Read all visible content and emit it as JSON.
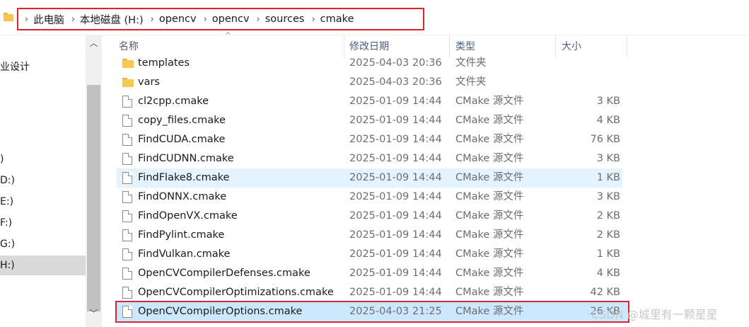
{
  "breadcrumb": [
    "此电脑",
    "本地磁盘 (H:)",
    "opencv",
    "opencv",
    "sources",
    "cmake"
  ],
  "nav": {
    "items": [
      "业设计",
      ")",
      "D:)",
      "E:)",
      "F:)",
      "G:)",
      "H:)"
    ],
    "selected": "H:)"
  },
  "columns": {
    "name": "名称",
    "date": "修改日期",
    "type": "类型",
    "size": "大小"
  },
  "files": [
    {
      "name": "templates",
      "date": "2025-04-03 20:36",
      "type": "文件夹",
      "size": "",
      "icon": "folder-icon"
    },
    {
      "name": "vars",
      "date": "2025-04-03 20:36",
      "type": "文件夹",
      "size": "",
      "icon": "folder-icon"
    },
    {
      "name": "cl2cpp.cmake",
      "date": "2025-01-09 14:44",
      "type": "CMake 源文件",
      "size": "3 KB",
      "icon": "file-icon"
    },
    {
      "name": "copy_files.cmake",
      "date": "2025-01-09 14:44",
      "type": "CMake 源文件",
      "size": "4 KB",
      "icon": "file-icon"
    },
    {
      "name": "FindCUDA.cmake",
      "date": "2025-01-09 14:44",
      "type": "CMake 源文件",
      "size": "76 KB",
      "icon": "file-icon"
    },
    {
      "name": "FindCUDNN.cmake",
      "date": "2025-01-09 14:44",
      "type": "CMake 源文件",
      "size": "3 KB",
      "icon": "file-icon"
    },
    {
      "name": "FindFlake8.cmake",
      "date": "2025-01-09 14:44",
      "type": "CMake 源文件",
      "size": "1 KB",
      "icon": "file-icon"
    },
    {
      "name": "FindONNX.cmake",
      "date": "2025-01-09 14:44",
      "type": "CMake 源文件",
      "size": "3 KB",
      "icon": "file-icon"
    },
    {
      "name": "FindOpenVX.cmake",
      "date": "2025-01-09 14:44",
      "type": "CMake 源文件",
      "size": "2 KB",
      "icon": "file-icon"
    },
    {
      "name": "FindPylint.cmake",
      "date": "2025-01-09 14:44",
      "type": "CMake 源文件",
      "size": "2 KB",
      "icon": "file-icon"
    },
    {
      "name": "FindVulkan.cmake",
      "date": "2025-01-09 14:44",
      "type": "CMake 源文件",
      "size": "1 KB",
      "icon": "file-icon"
    },
    {
      "name": "OpenCVCompilerDefenses.cmake",
      "date": "2025-01-09 14:44",
      "type": "CMake 源文件",
      "size": "4 KB",
      "icon": "file-icon"
    },
    {
      "name": "OpenCVCompilerOptimizations.cmake",
      "date": "2025-01-09 14:44",
      "type": "CMake 源文件",
      "size": "42 KB",
      "icon": "file-icon"
    },
    {
      "name": "OpenCVCompilerOptions.cmake",
      "date": "2025-04-03 21:25",
      "type": "CMake 源文件",
      "size": "26 KB",
      "icon": "file-icon"
    }
  ],
  "watermark": "CSDN @城里有一颗星星",
  "colors": {
    "highlight_outline": "#d8262f",
    "selected_row": "#cce8ff",
    "hover_row": "#e5f3ff"
  }
}
